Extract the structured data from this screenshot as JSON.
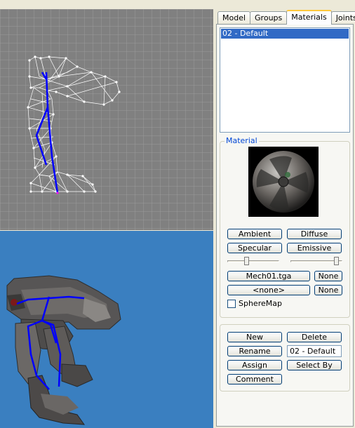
{
  "tabs": [
    {
      "label": "Model",
      "active": false
    },
    {
      "label": "Groups",
      "active": false
    },
    {
      "label": "Materials",
      "active": true
    },
    {
      "label": "Joints",
      "active": false
    }
  ],
  "materials_list": {
    "items": [
      "02 - Default"
    ],
    "selected_index": 0
  },
  "material_group": {
    "label": "Material",
    "buttons": {
      "ambient": "Ambient",
      "diffuse": "Diffuse",
      "specular": "Specular",
      "emissive": "Emissive"
    },
    "shininess_slider": 0.0,
    "transparency_slider": 1.0,
    "texture_button": "Mech01.tga",
    "texture_none": "None",
    "alpha_button": "<none>",
    "alpha_none": "None",
    "spheremap_label": "SphereMap",
    "spheremap_checked": false
  },
  "actions": {
    "new": "New",
    "delete": "Delete",
    "rename": "Rename",
    "name_value": "02 - Default",
    "assign": "Assign",
    "select_by": "Select By",
    "comment": "Comment"
  },
  "colors": {
    "ortho_bg": "#808080",
    "ortho_grid": "#9a9a9a",
    "persp_bg": "#3a7fc0",
    "bone": "#0000ff",
    "wire": "#ffffff",
    "selection": "#316ac5"
  }
}
